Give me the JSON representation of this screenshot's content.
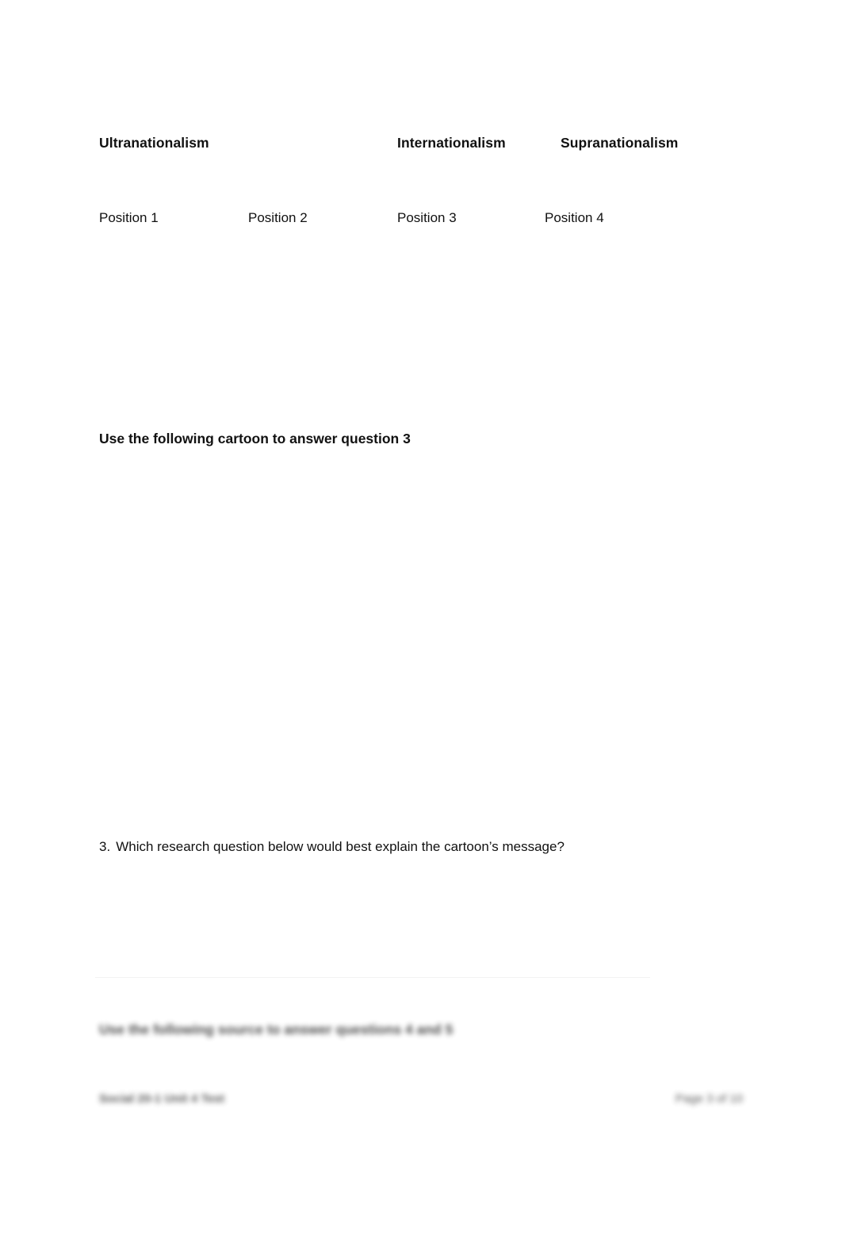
{
  "document": {
    "background_color": "#ffffff",
    "text_color": "#111111"
  },
  "spectrum": {
    "terms": [
      {
        "label": "Ultranationalism"
      },
      {
        "label": "Internationalism"
      },
      {
        "label": "Supranationalism"
      }
    ],
    "positions": [
      {
        "label": "Position 1"
      },
      {
        "label": "Position 2"
      },
      {
        "label": "Position 3"
      },
      {
        "label": "Position 4"
      }
    ]
  },
  "cartoon_section": {
    "instruction": "Use the following cartoon to answer question 3",
    "image_alt": ""
  },
  "question_3": {
    "number": "3.",
    "text": "Which research question below would best explain the cartoon’s message?"
  },
  "next_section": {
    "heading_blurred": "Use the following source to answer questions 4 and 5"
  },
  "footer": {
    "left_blurred": "Social 20-1 Unit 4 Test",
    "right_blurred": "Page 3 of 10"
  }
}
